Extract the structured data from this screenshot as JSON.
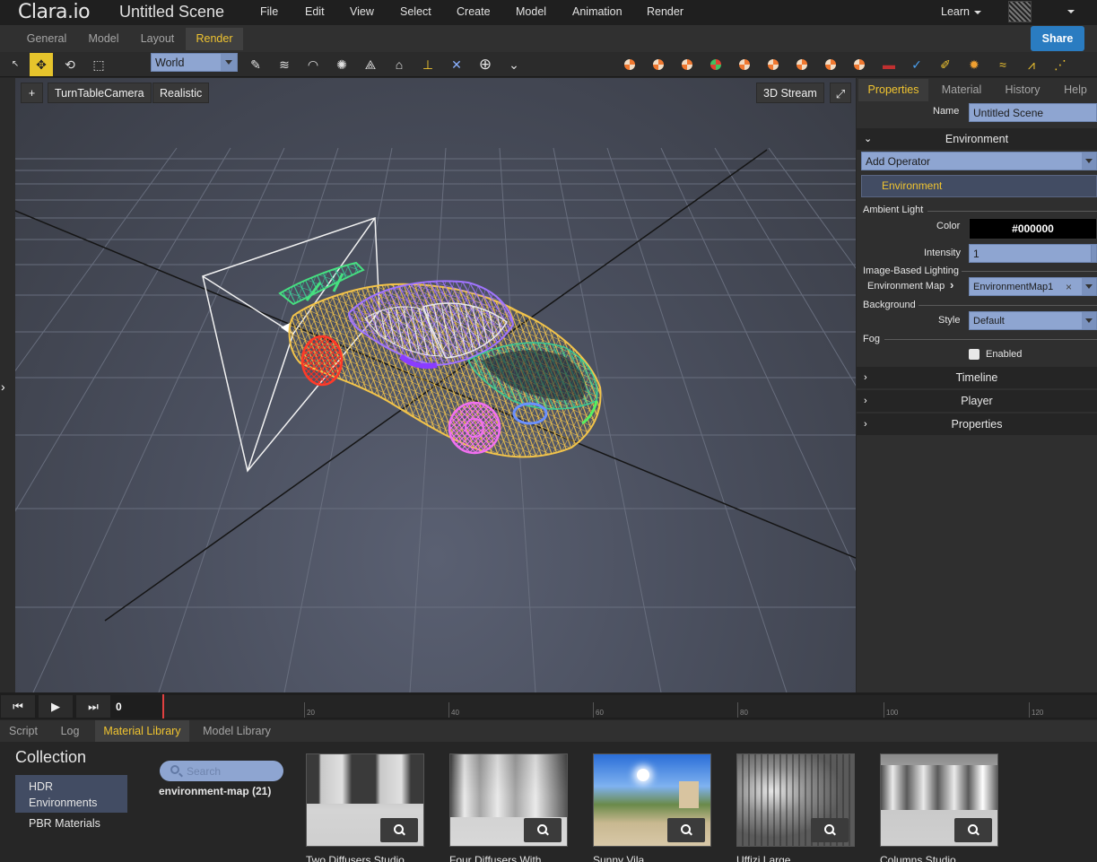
{
  "app": {
    "logo": "Clara.io",
    "scene_title": "Untitled Scene"
  },
  "menu": [
    "File",
    "Edit",
    "View",
    "Select",
    "Create",
    "Model",
    "Animation",
    "Render"
  ],
  "learn": "Learn",
  "share_label": "Share",
  "mode_tabs": [
    "General",
    "Model",
    "Layout",
    "Render"
  ],
  "toolbar": {
    "coordinate_space": "World"
  },
  "viewport": {
    "add_label": "+",
    "camera_label": "TurnTableCamera",
    "shading_label": "Realistic",
    "stream_label": "3D Stream"
  },
  "right_tabs": [
    "Properties",
    "Material",
    "History",
    "Help"
  ],
  "props": {
    "name_label": "Name",
    "name_value": "Untitled Scene",
    "section_environment": "Environment",
    "add_operator": "Add Operator",
    "operator_item": "Environment",
    "ambient_light": "Ambient Light",
    "color_label": "Color",
    "color_value": "#000000",
    "intensity_label": "Intensity",
    "intensity_value": "1",
    "ibl_label": "Image-Based Lighting",
    "env_map_label": "Environment Map",
    "env_map_value": "EnvironmentMap1",
    "background_label": "Background",
    "style_label": "Style",
    "style_value": "Default",
    "fog_label": "Fog",
    "enabled_label": "Enabled",
    "section_timeline": "Timeline",
    "section_player": "Player",
    "section_properties": "Properties"
  },
  "timeline": {
    "frame": "0",
    "ticks": [
      "20",
      "40",
      "60",
      "80",
      "100",
      "120"
    ]
  },
  "bottom_tabs": [
    "Script",
    "Log",
    "Material Library",
    "Model Library"
  ],
  "library": {
    "collection_title": "Collection",
    "collections": [
      "HDR Environments",
      "PBR Materials"
    ],
    "search_placeholder": "Search",
    "result_label": "environment-map (21)",
    "items": [
      "Two Diffusers Studio",
      "Four Diffusers With",
      "Sunny Vila",
      "Uffizi Large",
      "Columns Studio"
    ]
  },
  "colors": {
    "accent": "#f0c430",
    "field": "#8ea5d1",
    "share": "#2a7cc1"
  }
}
